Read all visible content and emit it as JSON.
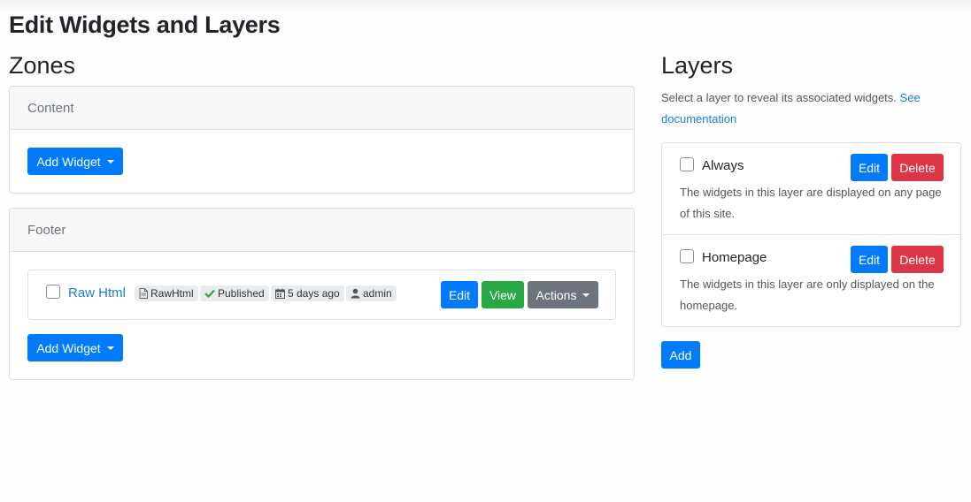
{
  "page": {
    "title": "Edit Widgets and Layers"
  },
  "zones": {
    "title": "Zones",
    "content_zone": {
      "header": "Content",
      "add_widget_label": "Add Widget"
    },
    "footer_zone": {
      "header": "Footer",
      "widget": {
        "title": "Raw Html",
        "type_badge": "RawHtml",
        "status_badge": "Published",
        "date_badge": "5 days ago",
        "author_badge": "admin",
        "edit_label": "Edit",
        "view_label": "View",
        "actions_label": "Actions"
      },
      "add_widget_label": "Add Widget"
    }
  },
  "layers": {
    "title": "Layers",
    "description": "Select a layer to reveal its associated widgets.",
    "doc_link": "See documentation",
    "items": [
      {
        "name": "Always",
        "description": "The widgets in this layer are displayed on any page of this site.",
        "edit_label": "Edit",
        "delete_label": "Delete"
      },
      {
        "name": "Homepage",
        "description": "The widgets in this layer are only displayed on the homepage.",
        "edit_label": "Edit",
        "delete_label": "Delete"
      }
    ],
    "add_label": "Add"
  },
  "colors": {
    "primary": "#007bff",
    "success": "#28a745",
    "secondary": "#6c757d",
    "danger": "#dc3545",
    "link": "#1a7fd4"
  },
  "icons": {
    "type_badge": "file-icon",
    "status_badge": "check-icon",
    "date_badge": "calendar-icon",
    "author_badge": "user-icon",
    "dropdown": "caret-down-icon"
  }
}
